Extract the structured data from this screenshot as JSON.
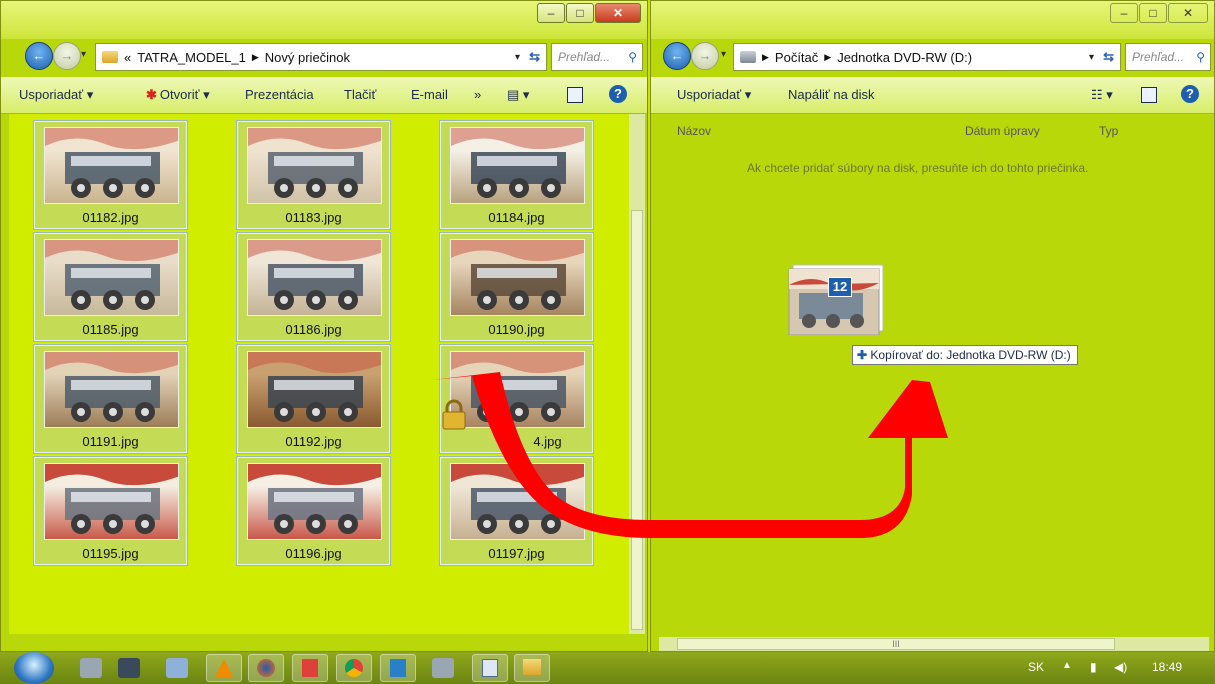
{
  "left_window": {
    "breadcrumb": {
      "prefix": "«",
      "items": [
        "TATRA_MODEL_1",
        "Nový priečinok"
      ]
    },
    "search_placeholder": "Prehľad...",
    "toolbar": {
      "organize": "Usporiadať",
      "open": "Otvoriť",
      "slideshow": "Prezentácia",
      "print": "Tlačiť",
      "email": "E-mail",
      "more": "»"
    },
    "files": [
      {
        "name": "01182.jpg"
      },
      {
        "name": "01183.jpg"
      },
      {
        "name": "01184.jpg"
      },
      {
        "name": "01185.jpg"
      },
      {
        "name": "01186.jpg"
      },
      {
        "name": "01190.jpg"
      },
      {
        "name": "01191.jpg"
      },
      {
        "name": "01192.jpg"
      },
      {
        "name": "01194.jpg",
        "visible_label": "4.jpg"
      },
      {
        "name": "01195.jpg"
      },
      {
        "name": "01196.jpg"
      },
      {
        "name": "01197.jpg"
      }
    ]
  },
  "right_window": {
    "breadcrumb": {
      "items": [
        "Počítač",
        "Jednotka DVD-RW (D:)"
      ]
    },
    "search_placeholder": "Prehľad...",
    "toolbar": {
      "organize": "Usporiadať",
      "burn": "Napáliť na disk"
    },
    "columns": {
      "name": "Názov",
      "date": "Dátum úpravy",
      "type": "Typ"
    },
    "empty_hint": "Ak chcete pridať súbory na disk, presuňte ich do tohto priečinka.",
    "scrollbar_grip": "III"
  },
  "drag": {
    "count": "12",
    "tooltip": "Kopírovať do: Jednotka DVD-RW (D:)"
  },
  "taskbar": {
    "language": "SK",
    "clock": "18:49"
  },
  "colors": {
    "background": "#c7e400",
    "arrow": "#ff0000",
    "accent": "#1d5fae"
  }
}
